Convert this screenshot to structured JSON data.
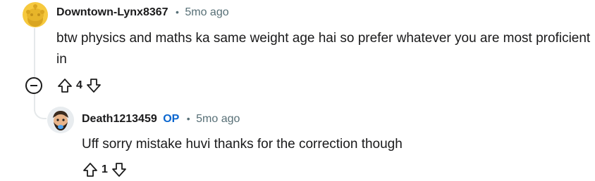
{
  "comments": [
    {
      "username": "Downtown-Lynx8367",
      "separator": "•",
      "time": "5mo ago",
      "body": "btw physics and maths ka same weight age hai so prefer whatever you are most proficient in",
      "votes": "4"
    },
    {
      "username": "Death1213459",
      "op_badge": "OP",
      "separator": "•",
      "time": "5mo ago",
      "body": "Uff sorry mistake huvi thanks for the correction though",
      "votes": "1"
    }
  ],
  "icons": {
    "upvote": "arrow-up-outline-icon",
    "downvote": "arrow-down-outline-icon",
    "collapse": "minus-circle-icon",
    "avatar1": "snoo-default-avatar",
    "avatar2": "custom-bearded-avatar"
  },
  "colors": {
    "avatar1_bg": "#f6c93e",
    "op_badge": "#0a66cf",
    "meta": "#576f76",
    "thread_line": "#e5e8ea"
  }
}
